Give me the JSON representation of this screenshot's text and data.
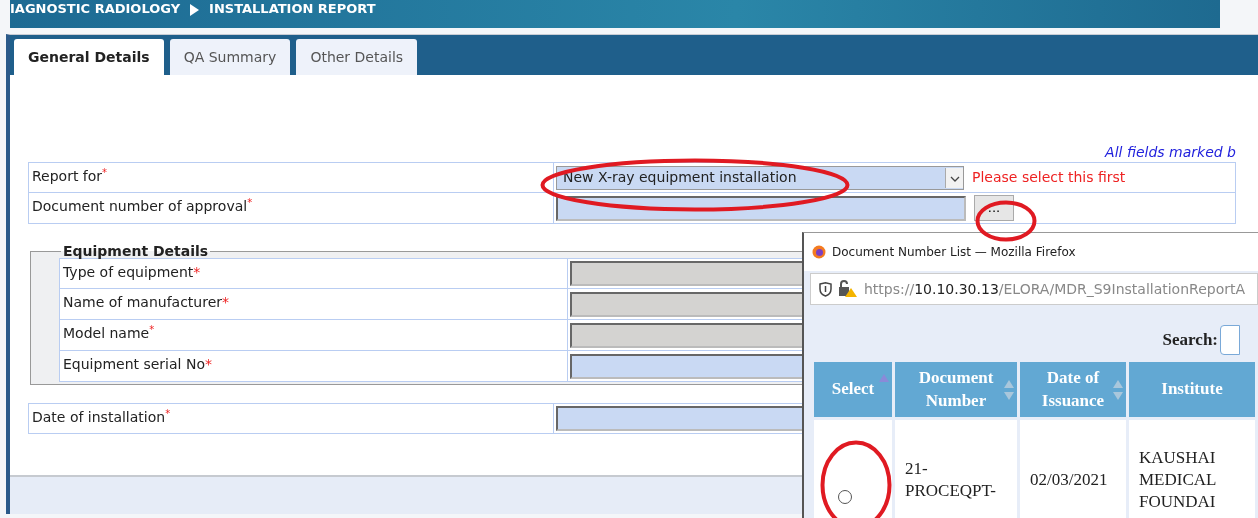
{
  "breadcrumb": [
    {
      "text": "IAGNOSTIC RADIOLOGY"
    },
    {
      "text": "INSTALLATION REPORT"
    }
  ],
  "tabs": [
    {
      "label": "General Details",
      "selected": true
    },
    {
      "label": "QA Summary",
      "selected": false
    },
    {
      "label": "Other Details",
      "selected": false
    }
  ],
  "required_note": "All fields marked b",
  "report_for": {
    "label": "Report for",
    "mark": "$^{*}$",
    "value": "New X-ray equipment installation",
    "hint": "Please select this first"
  },
  "document_number": {
    "label": "Document number of approval",
    "mark": "$^{*}$",
    "button": "..."
  },
  "equipment_details": {
    "legend": "Equipment Details",
    "fields": [
      {
        "label": "Type of equipment",
        "mark": "*",
        "disabled": true
      },
      {
        "label": "Name of manufacturer",
        "mark": "*",
        "disabled": true
      },
      {
        "label": "Model name",
        "mark": "$^{*}$",
        "disabled": true
      },
      {
        "label": "Equipment serial No",
        "mark": "*",
        "disabled": false
      }
    ]
  },
  "date_of_installation": {
    "label": "Date of installation",
    "mark": "$^{*}$"
  },
  "popup": {
    "title": "Document Number List — Mozilla Firefox",
    "url_scheme": "https://",
    "url_host": "10.10.30.13",
    "url_path": "/ELORA/MDR_S9InstallationReportA",
    "search_label": "Search:",
    "columns": [
      {
        "label": "Select",
        "sortable": true,
        "sorted": true
      },
      {
        "label": "Document Number",
        "sortable": true,
        "sorted": false
      },
      {
        "label": "Date of Issuance",
        "sortable": true,
        "sorted": false
      },
      {
        "label": "Institute",
        "sortable": false
      }
    ],
    "rows": [
      {
        "selected": false,
        "cells": [
          "",
          "21-\nPROCEQPT-",
          "02/03/2021",
          "KAUSHAI\nMEDICAL\nFOUNDAI"
        ]
      }
    ]
  }
}
